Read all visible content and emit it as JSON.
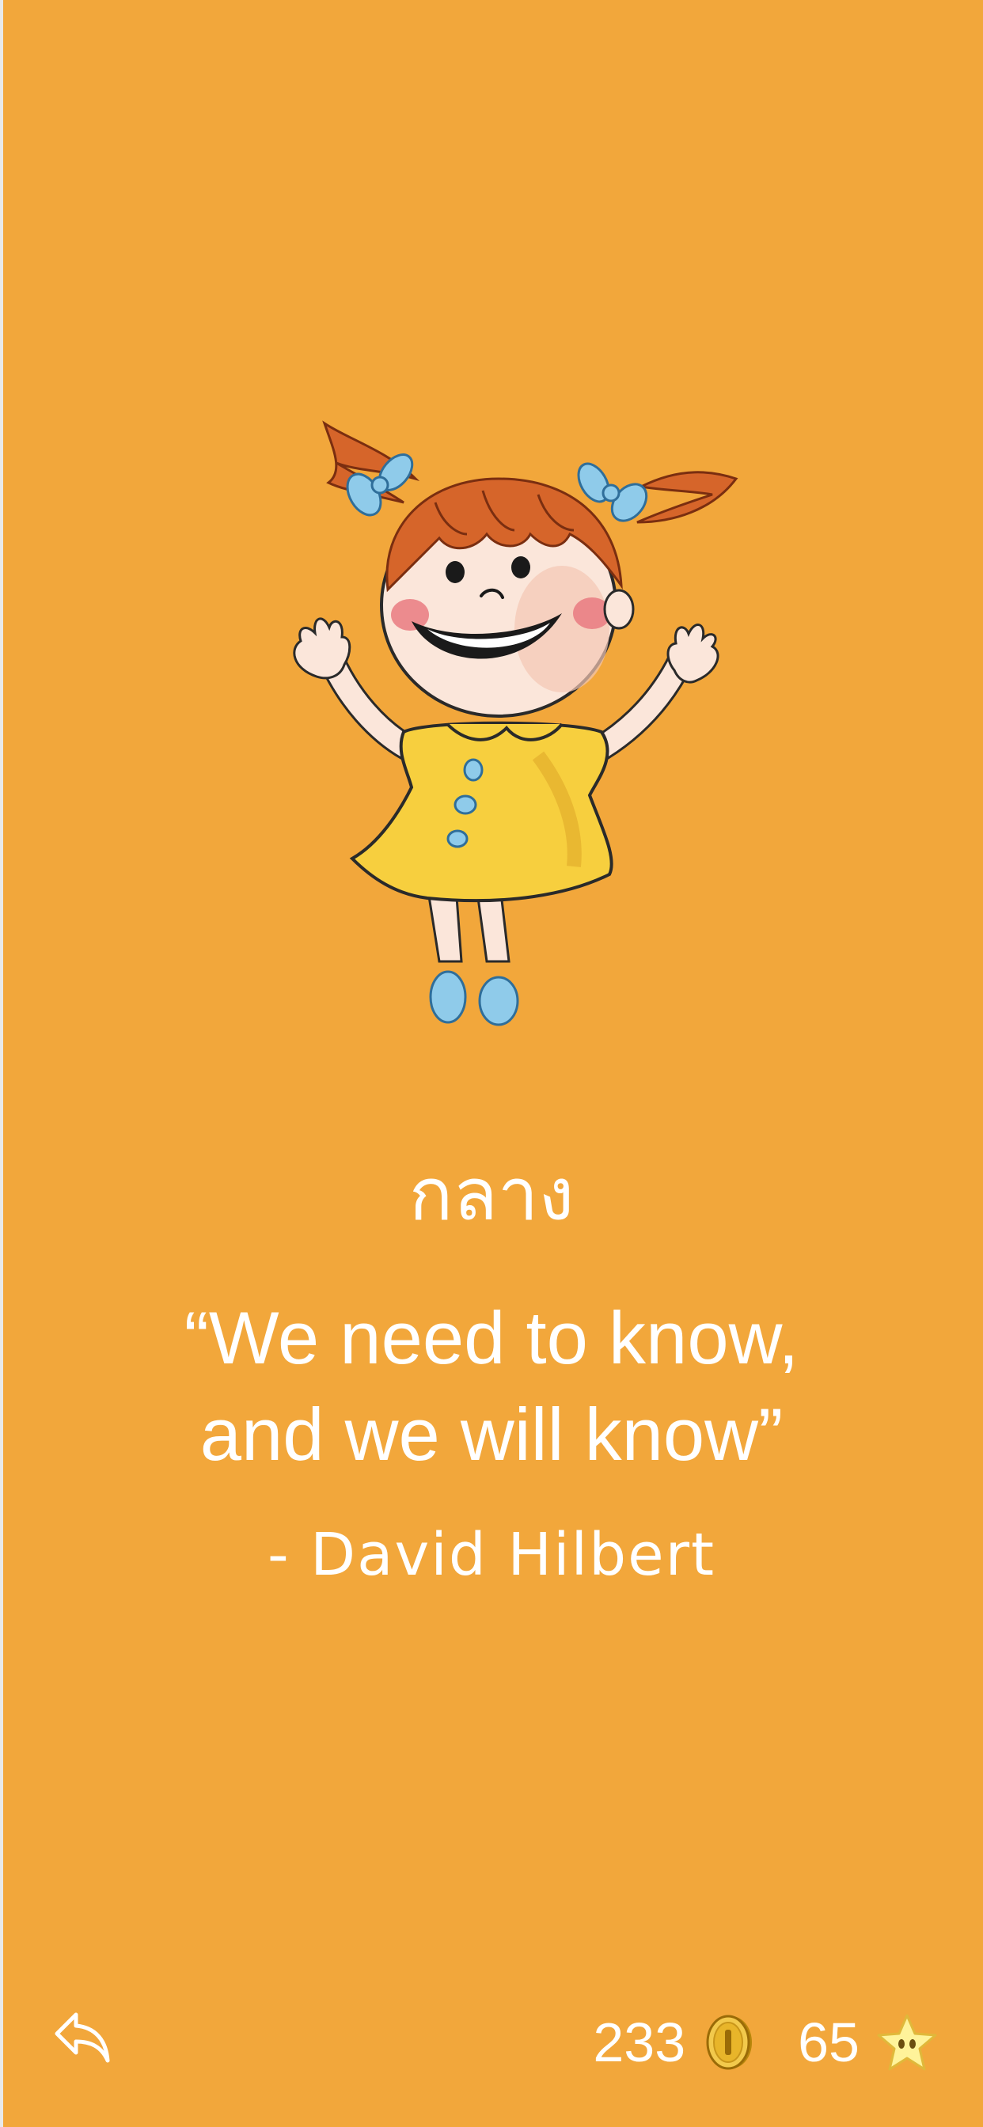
{
  "level": {
    "label": "กลาง"
  },
  "quote": {
    "text": "“We need to know, and we will know”",
    "author": "- David Hilbert"
  },
  "footer": {
    "coins": "233",
    "stars": "65",
    "coin_icon": "coin-icon",
    "star_icon": "star-icon",
    "back_icon": "reply-arrow-icon"
  },
  "colors": {
    "background": "#F2A73B",
    "text": "#FFFFFF",
    "coin": "#E8C23A",
    "star": "#FFF39A"
  }
}
